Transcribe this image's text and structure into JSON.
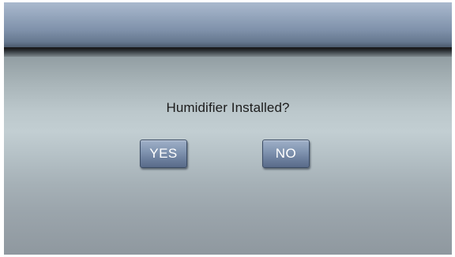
{
  "dialog": {
    "question": "Humidifier Installed?",
    "yes_label": "YES",
    "no_label": "NO"
  },
  "colors": {
    "header_top": "#aab9ce",
    "header_bottom": "#4b5a6c",
    "content_mid": "#c2ced2",
    "button_top": "#9fb0c8",
    "button_bottom": "#5a6c8a",
    "button_text": "#ffffff",
    "question_text": "#1c1c1c"
  }
}
